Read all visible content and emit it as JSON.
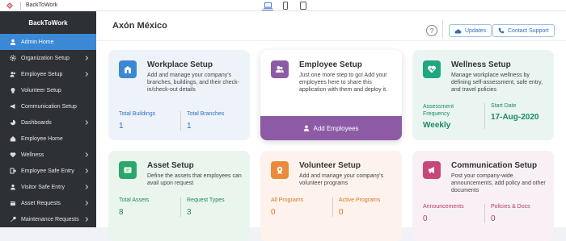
{
  "topbar": {
    "app_name": "BackToWork",
    "icons": [
      "logo-icon",
      "desktop-icon",
      "mobile-icon",
      "tablet-icon"
    ]
  },
  "sidebar": {
    "brand": "BackToWork",
    "items": [
      {
        "label": "Admin Home",
        "icon": "user-icon",
        "active": true
      },
      {
        "label": "Organization Setup",
        "icon": "gear-icon",
        "chevron": true
      },
      {
        "label": "Employee Setup",
        "icon": "users-icon",
        "chevron": true
      },
      {
        "label": "Volunteer Setup",
        "icon": "volunteer-icon"
      },
      {
        "label": "Communication Setup",
        "icon": "megaphone-icon"
      },
      {
        "label": "Dashboards",
        "icon": "pie-icon",
        "chevron": true
      },
      {
        "label": "Employee Home",
        "icon": "home-icon"
      },
      {
        "label": "Wellness",
        "icon": "heart-icon",
        "chevron": true
      },
      {
        "label": "Employee Safe Entry",
        "icon": "entry-icon",
        "chevron": true
      },
      {
        "label": "Visitor Safe Entry",
        "icon": "visitor-icon",
        "chevron": true
      },
      {
        "label": "Asset Requests",
        "icon": "box-icon",
        "chevron": true
      },
      {
        "label": "Maintenance Requests",
        "icon": "wrench-icon",
        "chevron": true
      }
    ]
  },
  "header": {
    "org_title": "Axón México",
    "help_label": "?",
    "updates_label": "Updates",
    "support_label": "Contact Support"
  },
  "cards": {
    "workplace": {
      "title": "Workplace Setup",
      "desc": "Add and manage your company's branches, buildings, and their check-in/check-out details",
      "stat1_label": "Total Buildings",
      "stat1_value": "1",
      "stat2_label": "Total Branches",
      "stat2_value": "1",
      "color": "#3b88d4"
    },
    "employee": {
      "title": "Employee Setup",
      "desc": "Just one more step to go! Add your employees here to share this application with them and deploy it.",
      "action_label": "Add Employees",
      "color": "#8d5ba6"
    },
    "wellness": {
      "title": "Wellness Setup",
      "desc": "Manage workplace wellness by defining self-assessment, safe entry, and travel policies",
      "stat1_label": "Assessment Frequency",
      "stat1_value": "Weekly",
      "stat2_label": "Start Date",
      "stat2_value": "17-Aug-2020",
      "color": "#1fa77f"
    },
    "asset": {
      "title": "Asset Setup",
      "desc": "Define the assets that employees can avail upon request",
      "stat1_label": "Total Assets",
      "stat1_value": "8",
      "stat2_label": "Request Types",
      "stat2_value": "3",
      "color": "#2aa86a"
    },
    "volunteer": {
      "title": "Volunteer Setup",
      "desc": "Add and manage your company's volunteer programs",
      "stat1_label": "All Programs",
      "stat1_value": "0",
      "stat2_label": "Active Programs",
      "stat2_value": "0",
      "color": "#e98b3b"
    },
    "communication": {
      "title": "Communication Setup",
      "desc": "Post your company-wide announcements, add policy and other documents",
      "stat1_label": "Announcements",
      "stat1_value": "0",
      "stat2_label": "Policies & Docs",
      "stat2_value": "0",
      "color": "#c8477a"
    }
  }
}
